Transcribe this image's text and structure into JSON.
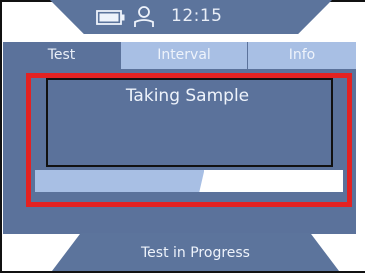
{
  "status": {
    "time": "12:15",
    "battery_icon": "battery-icon",
    "user_icon": "user-icon"
  },
  "tabs": [
    {
      "label": "Test",
      "active": true
    },
    {
      "label": "Interval",
      "active": false
    },
    {
      "label": "Info",
      "active": false
    }
  ],
  "main": {
    "message": "Taking Sample",
    "progress_fraction": 0.55
  },
  "footer": {
    "status_text": "Test in Progress"
  },
  "colors": {
    "panel": "#5b729b",
    "tab_inactive": "#a8bfe4",
    "highlight": "#e32222",
    "text": "#eef3fb"
  }
}
